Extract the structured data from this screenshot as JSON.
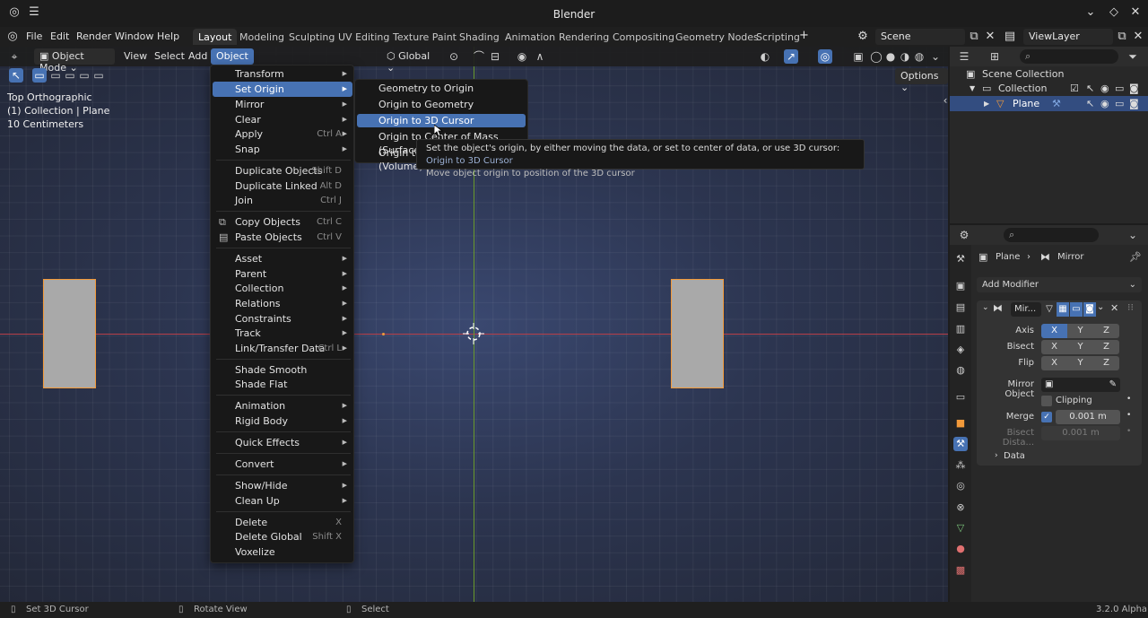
{
  "window": {
    "title": "Blender"
  },
  "menubar": {
    "items": [
      "File",
      "Edit",
      "Render",
      "Window",
      "Help"
    ],
    "workspaces": [
      "Layout",
      "Modeling",
      "Sculpting",
      "UV Editing",
      "Texture Paint",
      "Shading",
      "Animation",
      "Rendering",
      "Compositing",
      "Geometry Nodes",
      "Scripting"
    ],
    "active_workspace": "Layout",
    "scene": "Scene",
    "view_layer": "ViewLayer"
  },
  "viewport": {
    "mode": "Object Mode",
    "menus": [
      "View",
      "Select",
      "Add",
      "Object"
    ],
    "active_menu": "Object",
    "transform_orientation": "Global",
    "options_label": "Options",
    "info_lines": [
      "Top Orthographic",
      "(1) Collection | Plane",
      "10 Centimeters"
    ]
  },
  "object_menu": {
    "items": [
      {
        "label": "Transform",
        "arrow": true
      },
      {
        "label": "Set Origin",
        "arrow": true,
        "highlighted": true
      },
      {
        "label": "Mirror",
        "arrow": true
      },
      {
        "label": "Clear",
        "arrow": true
      },
      {
        "label": "Apply",
        "shortcut": "Ctrl A",
        "arrow": true
      },
      {
        "label": "Snap",
        "arrow": true
      },
      {
        "label": "Duplicate Objects",
        "shortcut": "Shift D"
      },
      {
        "label": "Duplicate Linked",
        "shortcut": "Alt D"
      },
      {
        "label": "Join",
        "shortcut": "Ctrl J"
      },
      {
        "label": "Copy Objects",
        "shortcut": "Ctrl C"
      },
      {
        "label": "Paste Objects",
        "shortcut": "Ctrl V"
      },
      {
        "label": "Asset",
        "arrow": true
      },
      {
        "label": "Parent",
        "arrow": true
      },
      {
        "label": "Collection",
        "arrow": true
      },
      {
        "label": "Relations",
        "arrow": true
      },
      {
        "label": "Constraints",
        "arrow": true
      },
      {
        "label": "Track",
        "arrow": true
      },
      {
        "label": "Link/Transfer Data",
        "shortcut": "Ctrl L",
        "arrow": true
      },
      {
        "label": "Shade Smooth"
      },
      {
        "label": "Shade Flat"
      },
      {
        "label": "Animation",
        "arrow": true
      },
      {
        "label": "Rigid Body",
        "arrow": true
      },
      {
        "label": "Quick Effects",
        "arrow": true
      },
      {
        "label": "Convert",
        "arrow": true
      },
      {
        "label": "Show/Hide",
        "arrow": true
      },
      {
        "label": "Clean Up",
        "arrow": true
      },
      {
        "label": "Delete",
        "shortcut": "X"
      },
      {
        "label": "Delete Global",
        "shortcut": "Shift X"
      },
      {
        "label": "Voxelize"
      }
    ]
  },
  "set_origin_submenu": {
    "items": [
      "Geometry to Origin",
      "Origin to Geometry",
      "Origin to 3D Cursor",
      "Origin to Center of Mass (Surface)",
      "Origin to Center of Mass (Volume)"
    ],
    "highlighted": "Origin to 3D Cursor"
  },
  "tooltip": {
    "description": "Set the object's origin, by either moving the data, or set to center of data, or use 3D cursor:",
    "python_hint": "Origin to 3D Cursor",
    "detail": "Move object origin to position of the 3D cursor"
  },
  "outliner": {
    "scene_collection": "Scene Collection",
    "collection": "Collection",
    "object": "Plane"
  },
  "properties": {
    "breadcrumb_object": "Plane",
    "breadcrumb_modifier": "Mirror",
    "add_modifier": "Add Modifier",
    "modifier_name": "Mir...",
    "rows": [
      {
        "label": "Axis",
        "buttons": [
          "X",
          "Y",
          "Z"
        ]
      },
      {
        "label": "Bisect",
        "buttons": [
          "X",
          "Y",
          "Z"
        ]
      },
      {
        "label": "Flip",
        "buttons": [
          "X",
          "Y",
          "Z"
        ]
      }
    ],
    "mirror_object_label": "Mirror Object",
    "clipping_label": "Clipping",
    "merge_label": "Merge",
    "merge_value": "0.001 m",
    "bisect_distance_label": "Bisect Dista...",
    "bisect_distance_value": "0.001 m",
    "data_label": "Data"
  },
  "statusbar": {
    "items": [
      "Set 3D Cursor",
      "Rotate View",
      "Select"
    ],
    "version": "3.2.0 Alpha"
  },
  "colors": {
    "accent": "#4772b3",
    "selection_outline": "#f29a3a",
    "x_axis": "#b8404a",
    "y_axis": "#6a9a2c"
  }
}
